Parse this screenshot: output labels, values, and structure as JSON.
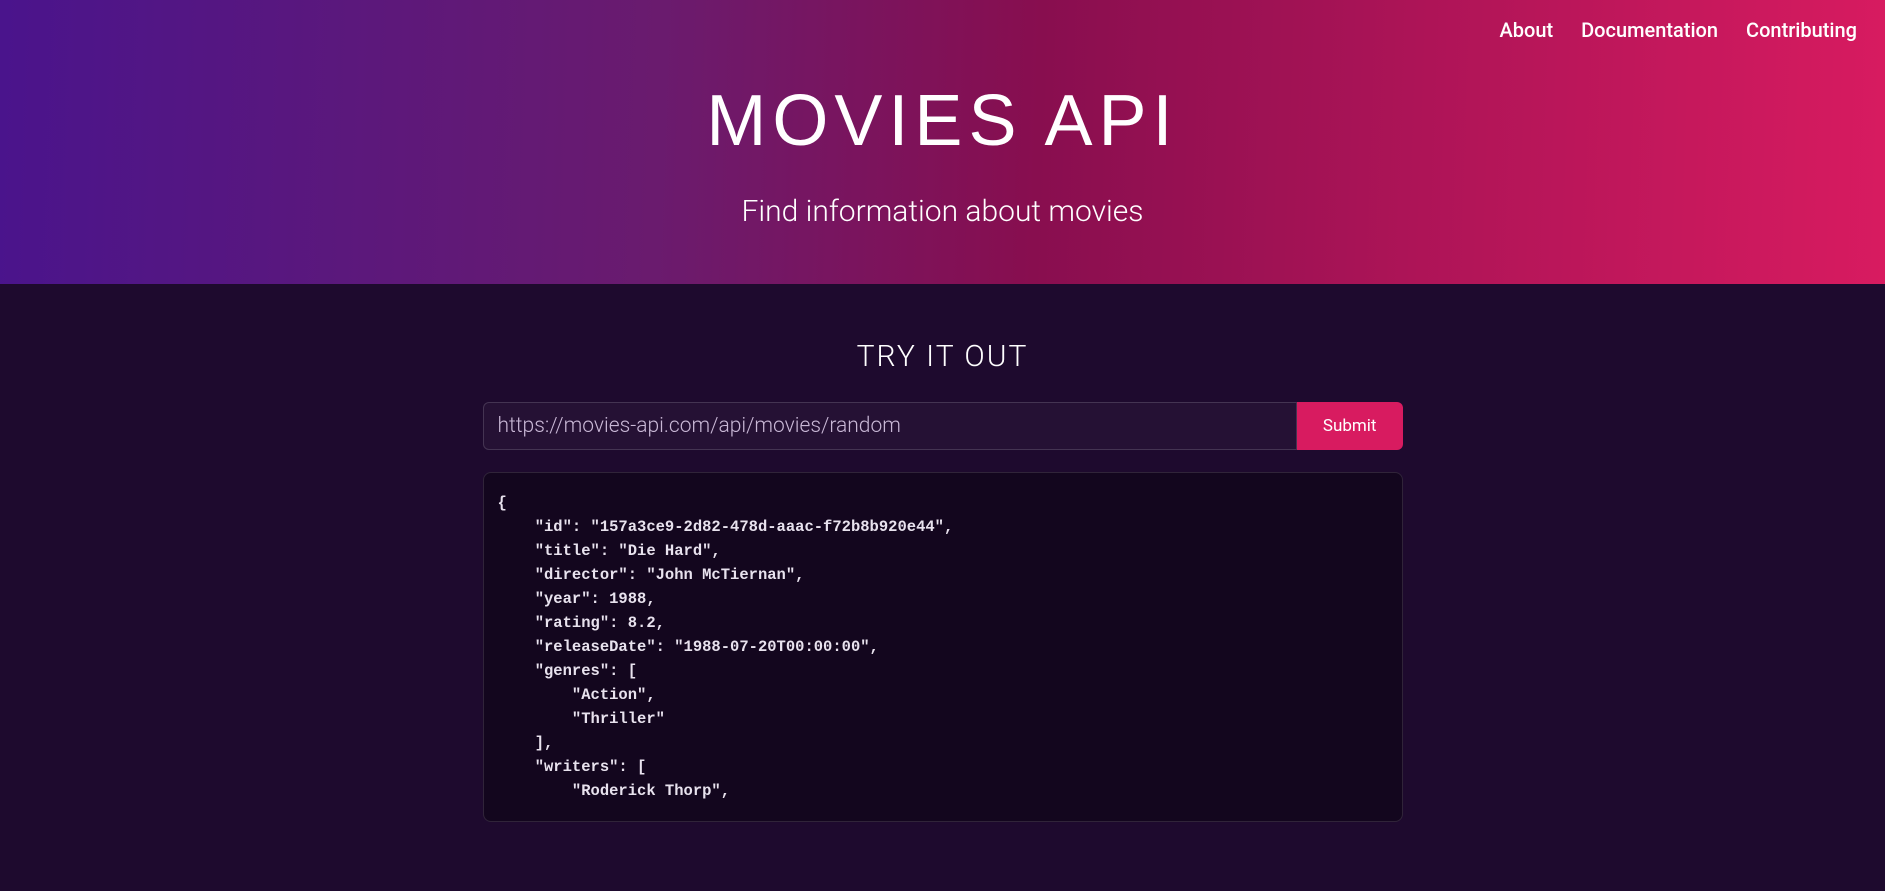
{
  "nav": {
    "items": [
      {
        "label": "About"
      },
      {
        "label": "Documentation"
      },
      {
        "label": "Contributing"
      }
    ]
  },
  "hero": {
    "title": "MOVIES API",
    "subtitle": "Find information about movies"
  },
  "tryout": {
    "title": "TRY IT OUT",
    "input_value": "https://movies-api.com/api/movies/random",
    "submit_label": "Submit"
  },
  "response": {
    "json_text": "{\n    \"id\": \"157a3ce9-2d82-478d-aaac-f72b8b920e44\",\n    \"title\": \"Die Hard\",\n    \"director\": \"John McTiernan\",\n    \"year\": 1988,\n    \"rating\": 8.2,\n    \"releaseDate\": \"1988-07-20T00:00:00\",\n    \"genres\": [\n        \"Action\",\n        \"Thriller\"\n    ],\n    \"writers\": [\n        \"Roderick Thorp\","
  }
}
